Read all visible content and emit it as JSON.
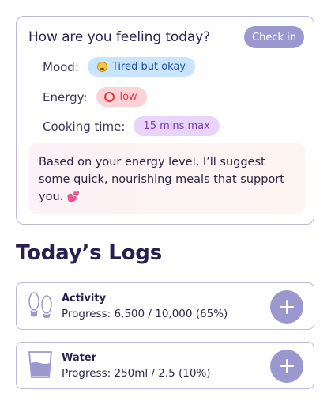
{
  "mood_card": {
    "title": "How are you feeling today?",
    "checkin_label": "Check in",
    "mood_label": "Mood:",
    "mood_value": "Tired but okay",
    "mood_icon": "tired-face-icon",
    "energy_label": "Energy:",
    "energy_value": "low",
    "energy_icon": "red-ring-icon",
    "cooking_label": "Cooking time:",
    "cooking_value": "15 mins max",
    "suggestion": "Based on your energy level, I’ll suggest some quick, nourishing meals that support you.",
    "suggestion_emoji": "💕"
  },
  "logs": {
    "title": "Today’s Logs",
    "items": [
      {
        "name": "Activity",
        "progress": "Progress: 6,500 / 10,000 (65%)",
        "percent": 65,
        "icon": "footprints-icon",
        "add_icon": "plus-icon"
      },
      {
        "name": "Water",
        "progress": "Progress: 250ml / 2.5 (10%)",
        "percent": 10,
        "icon": "water-glass-icon",
        "add_icon": "plus-icon"
      }
    ]
  },
  "colors": {
    "accent": "#9b98cf",
    "border": "#bdb8dc",
    "mood_pill": "#c9e4ff",
    "energy_pill": "#fbd2d6",
    "cooking_pill": "#e9d4fb",
    "heading": "#2a2050"
  }
}
